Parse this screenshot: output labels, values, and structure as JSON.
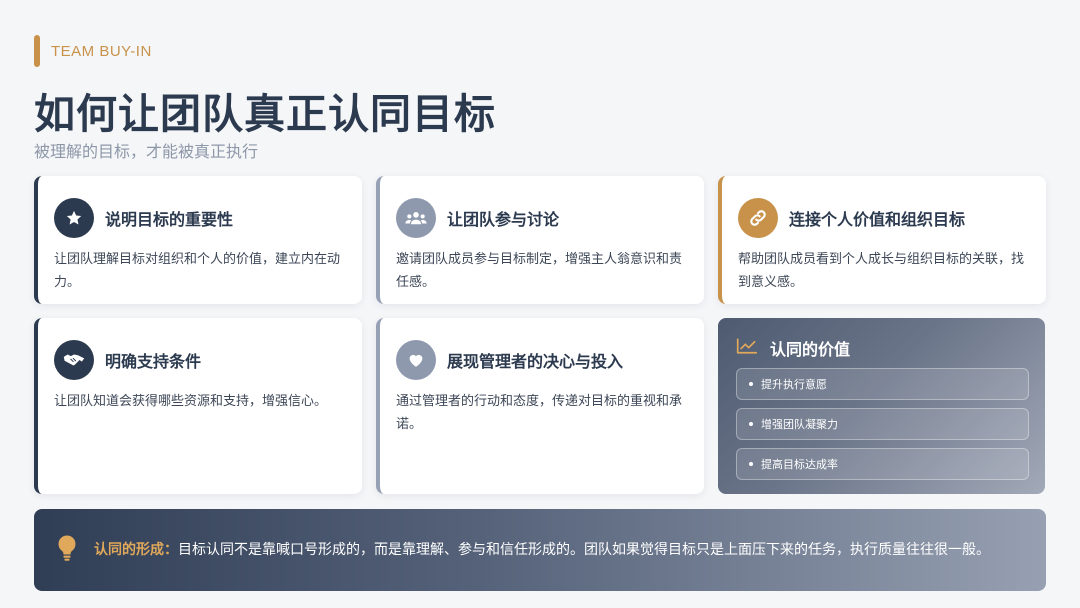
{
  "eyebrow": "TEAM BUY-IN",
  "title": "如何让团队真正认同目标",
  "subtitle": "被理解的目标，才能被真正执行",
  "cards": [
    {
      "title": "说明目标的重要性",
      "desc": "让团队理解目标对组织和个人的价值，建立内在动力。",
      "icon": "star-icon"
    },
    {
      "title": "让团队参与讨论",
      "desc": "邀请团队成员参与目标制定，增强主人翁意识和责任感。",
      "icon": "team-icon"
    },
    {
      "title": "连接个人价值和组织目标",
      "desc": "帮助团队成员看到个人成长与组织目标的关联，找到意义感。",
      "icon": "link-icon"
    },
    {
      "title": "明确支持条件",
      "desc": "让团队知道会获得哪些资源和支持，增强信心。",
      "icon": "handshake-icon"
    },
    {
      "title": "展现管理者的决心与投入",
      "desc": "通过管理者的行动和态度，传递对目标的重视和承诺。",
      "icon": "heart-icon"
    }
  ],
  "value_panel": {
    "title": "认同的价值",
    "items": [
      "提升执行意愿",
      "增强团队凝聚力",
      "提高目标达成率"
    ],
    "icon": "chart-line-icon"
  },
  "footer": {
    "label": "认同的形成：",
    "text": "目标认同不是靠喊口号形成的，而是靠理解、参与和信任形成的。团队如果觉得目标只是上面压下来的任务，执行质量往往很一般。",
    "icon": "lightbulb-icon"
  },
  "colors": {
    "navy": "#2c3a4f",
    "gold": "#c8924a",
    "slate": "#8f99ae",
    "background": "#f5f6f8"
  }
}
